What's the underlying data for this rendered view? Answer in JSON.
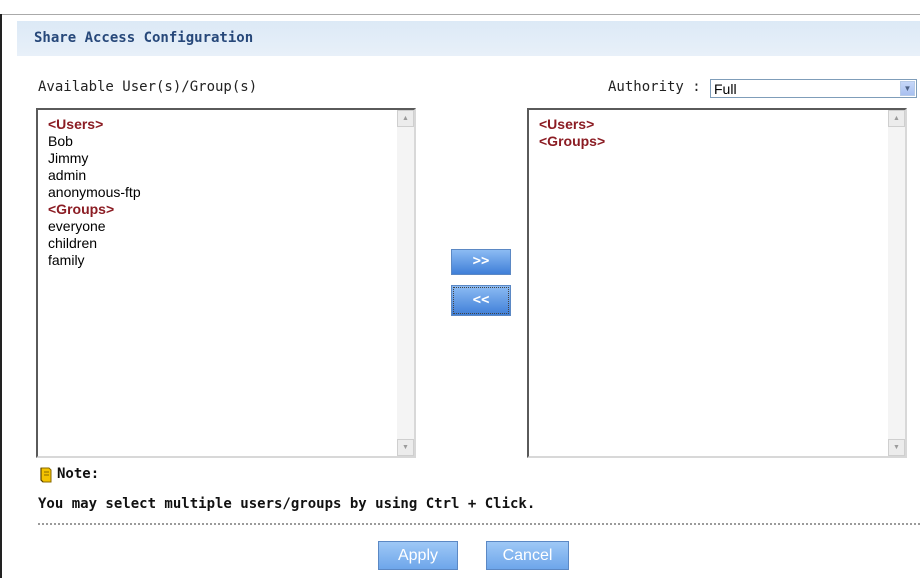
{
  "panel": {
    "title": "Share Access Configuration"
  },
  "available": {
    "label": "Available User(s)/Group(s)",
    "items": [
      {
        "text": "<Users>",
        "header": true
      },
      {
        "text": "Bob",
        "header": false
      },
      {
        "text": "Jimmy",
        "header": false
      },
      {
        "text": "admin",
        "header": false
      },
      {
        "text": "anonymous-ftp",
        "header": false
      },
      {
        "text": "<Groups>",
        "header": true
      },
      {
        "text": "everyone",
        "header": false
      },
      {
        "text": "children",
        "header": false
      },
      {
        "text": "family",
        "header": false
      }
    ]
  },
  "authority": {
    "label": "Authority :",
    "selected": "Full"
  },
  "assigned": {
    "items": [
      {
        "text": "<Users>",
        "header": true
      },
      {
        "text": "<Groups>",
        "header": true
      }
    ]
  },
  "move_buttons": {
    "add": ">>",
    "remove": "<<"
  },
  "note": {
    "label": "Note:",
    "text": "You may select multiple users/groups by using Ctrl + Click."
  },
  "actions": {
    "apply": "Apply",
    "cancel": "Cancel"
  },
  "colors": {
    "title_text": "#27487a",
    "header_item": "#8b1c23",
    "button_blue": "#3f7fd8"
  },
  "icons": {
    "note": "note-book-icon",
    "scroll_up": "scroll-up-arrow-icon",
    "scroll_down": "scroll-down-arrow-icon",
    "dropdown": "chevron-down-icon"
  }
}
